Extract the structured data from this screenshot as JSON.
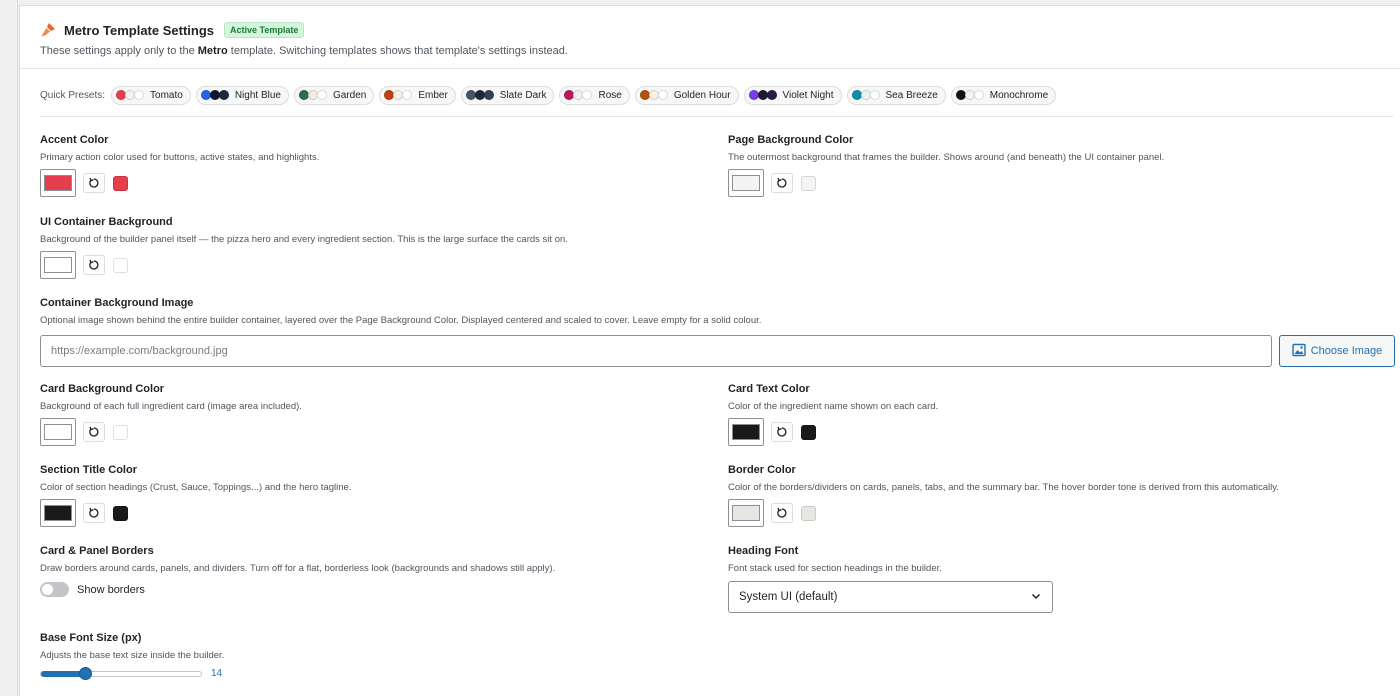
{
  "header": {
    "title": "Metro Template Settings",
    "badge": "Active Template",
    "subtitle_pre": "These settings apply only to the ",
    "subtitle_bold": "Metro",
    "subtitle_post": " template. Switching templates shows that template's settings instead."
  },
  "presets": {
    "label": "Quick Presets:",
    "items": [
      {
        "label": "Tomato",
        "colors": [
          "#e53e4d",
          "#f4f4f4",
          "#ffffff"
        ]
      },
      {
        "label": "Night Blue",
        "colors": [
          "#2563eb",
          "#0f172a",
          "#1e293b"
        ]
      },
      {
        "label": "Garden",
        "colors": [
          "#2f6b4f",
          "#efeee4",
          "#ffffff"
        ]
      },
      {
        "label": "Ember",
        "colors": [
          "#c2410c",
          "#f5f0ea",
          "#ffffff"
        ]
      },
      {
        "label": "Slate Dark",
        "colors": [
          "#475569",
          "#1e293b",
          "#334155"
        ]
      },
      {
        "label": "Rose",
        "colors": [
          "#be185d",
          "#f8eef2",
          "#ffffff"
        ]
      },
      {
        "label": "Golden Hour",
        "colors": [
          "#b45309",
          "#fbf1e1",
          "#ffffff"
        ]
      },
      {
        "label": "Violet Night",
        "colors": [
          "#7c3aed",
          "#1e1b2e",
          "#2e1a47"
        ]
      },
      {
        "label": "Sea Breeze",
        "colors": [
          "#0e8fa8",
          "#e8f4f6",
          "#ffffff"
        ]
      },
      {
        "label": "Monochrome",
        "colors": [
          "#111111",
          "#f4f4f4",
          "#ffffff"
        ]
      }
    ]
  },
  "fields": {
    "accent": {
      "label": "Accent Color",
      "desc": "Primary action color used for buttons, active states, and highlights.",
      "color": "#e53e4d"
    },
    "page_bg": {
      "label": "Page Background Color",
      "desc": "The outermost background that frames the builder. Shows around (and beneath) the UI container panel.",
      "color": "#f4f4f4"
    },
    "ui_bg": {
      "label": "UI Container Background",
      "desc": "Background of the builder panel itself — the pizza hero and every ingredient section. This is the large surface the cards sit on.",
      "color": "#ffffff"
    },
    "bg_image": {
      "label": "Container Background Image",
      "desc": "Optional image shown behind the entire builder container, layered over the Page Background Color. Displayed centered and scaled to cover. Leave empty for a solid colour.",
      "placeholder": "https://example.com/background.jpg",
      "button": "Choose Image"
    },
    "card_bg": {
      "label": "Card Background Color",
      "desc": "Background of each full ingredient card (image area included).",
      "color": "#ffffff"
    },
    "card_text": {
      "label": "Card Text Color",
      "desc": "Color of the ingredient name shown on each card.",
      "color": "#1a1a1a"
    },
    "section_title": {
      "label": "Section Title Color",
      "desc": "Color of section headings (Crust, Sauce, Toppings...) and the hero tagline.",
      "color": "#1a1a1a"
    },
    "border": {
      "label": "Border Color",
      "desc": "Color of the borders/dividers on cards, panels, tabs, and the summary bar. The hover border tone is derived from this automatically.",
      "color": "#e6e6e2"
    },
    "borders_toggle": {
      "label": "Card & Panel Borders",
      "desc": "Draw borders around cards, panels, and dividers. Turn off for a flat, borderless look (backgrounds and shadows still apply).",
      "toggle_label": "Show borders",
      "enabled": false
    },
    "heading_font": {
      "label": "Heading Font",
      "desc": "Font stack used for section headings in the builder.",
      "value": "System UI (default)"
    },
    "font_size": {
      "label": "Base Font Size (px)",
      "desc": "Adjusts the base text size inside the builder.",
      "value": "14",
      "fraction": 0.27
    }
  }
}
